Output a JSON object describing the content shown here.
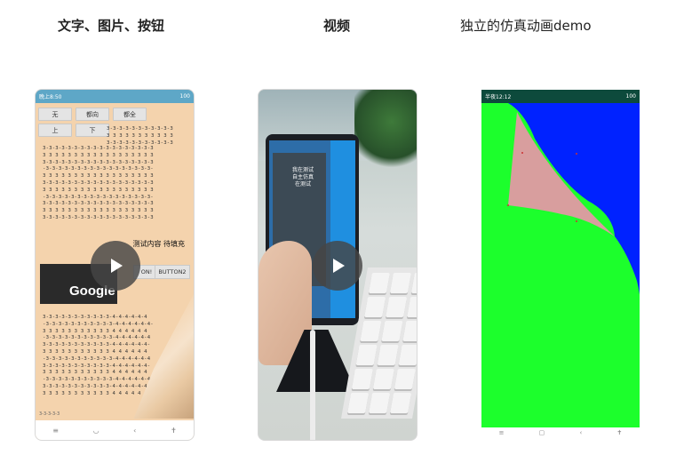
{
  "headings": {
    "text_images_buttons": "文字、图片、按钮",
    "video": "视频",
    "demo": "独立的仿真动画demo"
  },
  "phone1": {
    "status_left": "晚上8:50",
    "status_right": "100",
    "top_buttons": [
      "无",
      "都向",
      "都全"
    ],
    "mid_buttons": [
      "上",
      "下"
    ],
    "label": "测试内容 待填充",
    "button1": "ON!",
    "button2": "BUTTON2",
    "logo": "Google",
    "footer": "3-3-3-3-3",
    "nav_icons": [
      "menu-icon",
      "home-icon",
      "back-icon",
      "accessibility-icon"
    ]
  },
  "phone2": {
    "screen_text": "我在测试\n自主仿真\n在测试"
  },
  "phone3": {
    "status_left": "半夜12:12",
    "status_right": "100",
    "colors": {
      "background": "#0022ff",
      "page": "#1cff2c",
      "fold": "#d89e9e"
    },
    "nav_icons": [
      "menu-icon",
      "home-icon",
      "back-icon",
      "accessibility-icon"
    ]
  }
}
